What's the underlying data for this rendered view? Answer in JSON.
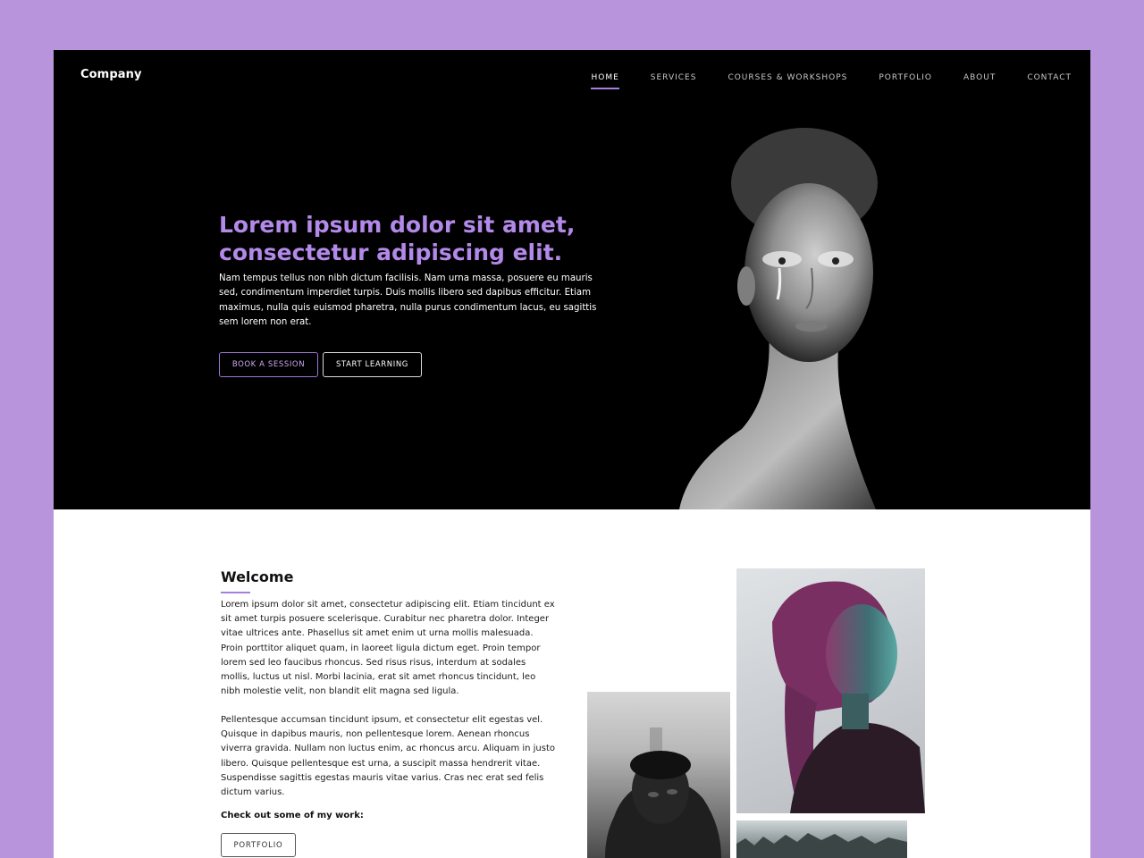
{
  "header": {
    "logo": "Company",
    "nav": [
      {
        "label": "HOME",
        "active": true
      },
      {
        "label": "SERVICES",
        "active": false
      },
      {
        "label": "COURSES & WORKSHOPS",
        "active": false
      },
      {
        "label": "PORTFOLIO",
        "active": false
      },
      {
        "label": "ABOUT",
        "active": false
      },
      {
        "label": "CONTACT",
        "active": false
      }
    ]
  },
  "hero": {
    "title": "Lorem ipsum dolor sit amet, consectetur adipiscing elit.",
    "text": "Nam tempus tellus non nibh dictum facilisis. Nam urna massa, posuere eu mauris sed, condimentum imperdiet turpis. Duis mollis libero sed dapibus efficitur. Etiam maximus, nulla quis euismod pharetra, nulla purus condimentum lacus, eu sagittis sem lorem non erat.",
    "book_label": "BOOK A SESSION",
    "learn_label": "START LEARNING"
  },
  "welcome": {
    "title": "Welcome",
    "paragraph_1": "Lorem ipsum dolor sit amet, consectetur adipiscing elit. Etiam tincidunt ex sit amet turpis posuere scelerisque. Curabitur nec pharetra dolor. Integer vitae ultrices ante. Phasellus sit amet enim ut urna mollis malesuada. Proin porttitor aliquet quam, in laoreet ligula dictum eget. Proin tempor lorem sed leo faucibus rhoncus. Sed risus risus, interdum at sodales mollis, luctus ut nisl. Morbi lacinia, erat sit amet rhoncus tincidunt, leo nibh molestie velit, non blandit elit magna sed ligula.",
    "paragraph_2": "Pellentesque accumsan tincidunt ipsum, et consectetur elit egestas vel. Quisque in dapibus mauris, non pellentesque lorem. Aenean rhoncus viverra gravida. Nullam non luctus enim, ac rhoncus arcu. Aliquam in justo libero. Quisque pellentesque est urna, a suscipit massa hendrerit vitae. Suspendisse sagittis egestas mauris vitae varius. Cras nec erat sed felis dictum varius.",
    "work_label": "Check out some of my work:",
    "portfolio_label": "PORTFOLIO"
  },
  "colors": {
    "page_background": "#b794dc",
    "accent": "#a77fe0",
    "hero_title": "#b389ea",
    "hero_background": "#000000"
  }
}
